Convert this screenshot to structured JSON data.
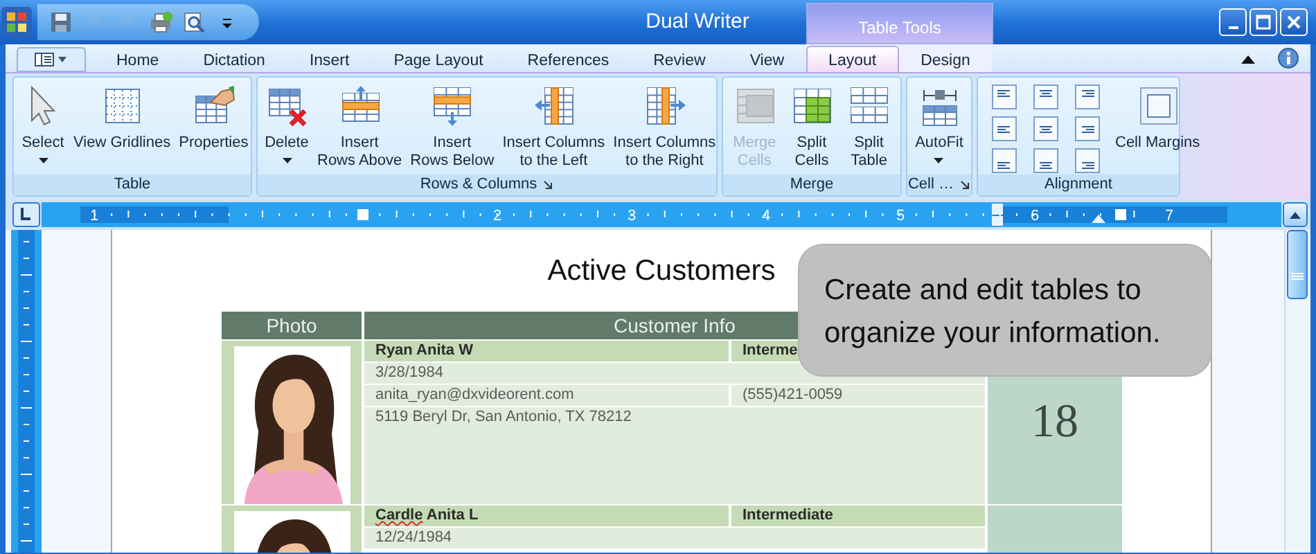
{
  "window": {
    "title": "Dual Writer",
    "context_tab": "Table Tools"
  },
  "quick_access": [
    {
      "kind": "save",
      "disabled": false
    },
    {
      "kind": "undo",
      "disabled": true
    },
    {
      "kind": "redo",
      "disabled": true
    },
    {
      "kind": "print",
      "disabled": false
    },
    {
      "kind": "preview",
      "disabled": false
    },
    {
      "kind": "customize",
      "disabled": false
    }
  ],
  "tabs": [
    {
      "label": "Home",
      "selected": false,
      "contextual": false
    },
    {
      "label": "Dictation",
      "selected": false,
      "contextual": false
    },
    {
      "label": "Insert",
      "selected": false,
      "contextual": false
    },
    {
      "label": "Page Layout",
      "selected": false,
      "contextual": false
    },
    {
      "label": "References",
      "selected": false,
      "contextual": false
    },
    {
      "label": "Review",
      "selected": false,
      "contextual": false
    },
    {
      "label": "View",
      "selected": false,
      "contextual": false
    },
    {
      "label": "Layout",
      "selected": true,
      "contextual": true
    },
    {
      "label": "Design",
      "selected": false,
      "contextual": true
    }
  ],
  "ribbon": {
    "groups": [
      {
        "title": "Table",
        "launcher": false,
        "commands": [
          {
            "kind": "select",
            "lines": [
              "Select"
            ],
            "dropdown": true,
            "disabled": false
          },
          {
            "kind": "gridlines",
            "lines": [
              "View Gridlines"
            ],
            "dropdown": false,
            "disabled": false
          },
          {
            "kind": "properties",
            "lines": [
              "Properties"
            ],
            "dropdown": false,
            "disabled": false
          }
        ]
      },
      {
        "title": "Rows & Columns",
        "launcher": true,
        "commands": [
          {
            "kind": "delete",
            "lines": [
              "Delete"
            ],
            "dropdown": true,
            "disabled": false
          },
          {
            "kind": "rows_above",
            "lines": [
              "Insert",
              "Rows Above"
            ],
            "dropdown": false,
            "disabled": false
          },
          {
            "kind": "rows_below",
            "lines": [
              "Insert",
              "Rows Below"
            ],
            "dropdown": false,
            "disabled": false
          },
          {
            "kind": "cols_left",
            "lines": [
              "Insert Columns",
              "to the Left"
            ],
            "dropdown": false,
            "disabled": false
          },
          {
            "kind": "cols_right",
            "lines": [
              "Insert Columns",
              "to the Right"
            ],
            "dropdown": false,
            "disabled": false
          }
        ]
      },
      {
        "title": "Merge",
        "launcher": false,
        "commands": [
          {
            "kind": "merge",
            "lines": [
              "Merge",
              "Cells"
            ],
            "dropdown": false,
            "disabled": true
          },
          {
            "kind": "split_cells",
            "lines": [
              "Split",
              "Cells"
            ],
            "dropdown": false,
            "disabled": false
          },
          {
            "kind": "split_table",
            "lines": [
              "Split",
              "Table"
            ],
            "dropdown": false,
            "disabled": false
          }
        ]
      },
      {
        "title": "Cell …",
        "launcher": true,
        "commands": [
          {
            "kind": "autofit",
            "lines": [
              "AutoFit"
            ],
            "dropdown": true,
            "disabled": false
          }
        ]
      },
      {
        "title": "Alignment",
        "launcher": false,
        "commands": [
          {
            "kind": "alignment"
          },
          {
            "kind": "cell_margins",
            "lines": [
              "Cell Margins"
            ],
            "dropdown": false,
            "disabled": false
          }
        ]
      }
    ]
  },
  "ruler": {
    "labels": [
      "1",
      "2",
      "3",
      "4",
      "5",
      "6",
      "7"
    ]
  },
  "document": {
    "title": "Active Customers",
    "table": {
      "columns": [
        "Photo",
        "Customer Info"
      ],
      "rows": [
        {
          "name": "Ryan Anita W",
          "name_misspelled": false,
          "membership": "Interme",
          "birth_date": "3/28/1984",
          "email": "anita_ryan@dxvideorent.com",
          "phone": "(555)421-0059",
          "address": "5119 Beryl Dr, San Antonio, TX 78212",
          "count": "18"
        },
        {
          "name": "Cardle Anita L",
          "name_misspelled": true,
          "membership": "Intermediate",
          "birth_date": "12/24/1984"
        }
      ]
    }
  },
  "tooltip": {
    "lines": [
      "Create and edit tables to",
      "organize your information."
    ]
  }
}
